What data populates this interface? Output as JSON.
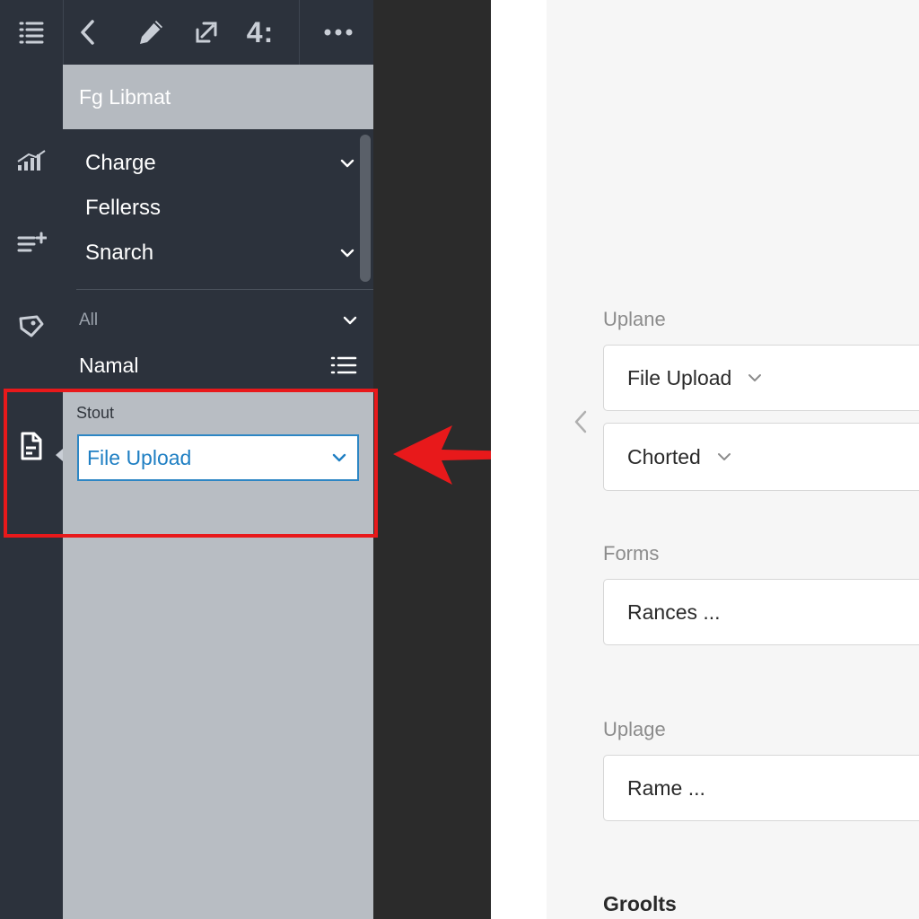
{
  "toolbar": {
    "icons": [
      "list-icon",
      "back-chevron-icon",
      "pencil-icon",
      "expand-icon",
      "more-icon"
    ],
    "counter_text": "4:"
  },
  "rail": {
    "icons": [
      "signal-chart-icon",
      "add-list-icon",
      "tag-icon",
      "document-icon"
    ]
  },
  "panel": {
    "title": "Fg Libmat",
    "menu": [
      {
        "label": "Charge",
        "has_chevron": true
      },
      {
        "label": "Fellerss",
        "has_chevron": false
      },
      {
        "label": "Snarch",
        "has_chevron": true
      }
    ],
    "filter_label": "All",
    "view_label": "Namal",
    "field_label": "Stout",
    "field_value": "File Upload"
  },
  "form": {
    "groups": [
      {
        "label": "Uplane",
        "fields": [
          "File Upload",
          "Chorted"
        ]
      },
      {
        "label": "Forms",
        "fields": [
          "Rances ..."
        ]
      },
      {
        "label": "Uplage",
        "fields": [
          "Rame ..."
        ]
      }
    ],
    "section_title": "Groolts"
  },
  "colors": {
    "highlight": "#e8191b",
    "accent": "#1f7fc3",
    "dark_bg": "#2c323c"
  }
}
